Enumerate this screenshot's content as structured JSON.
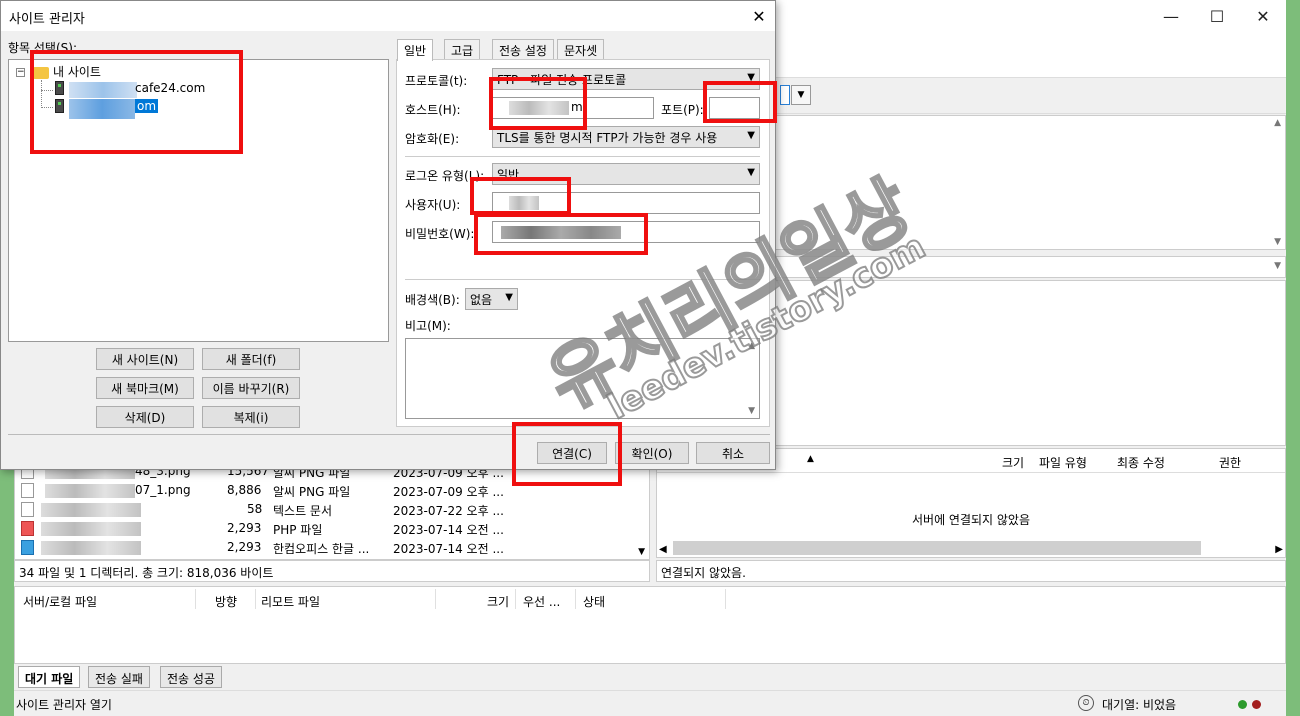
{
  "app": {
    "window_controls": {
      "minimize": "—",
      "maximize": "☐",
      "close": "✕"
    },
    "local_files": [
      {
        "name_suffix": "48_3.png",
        "size": "15,567",
        "type": "알씨 PNG 파일",
        "modified": "2023-07-09 오후 ..."
      },
      {
        "name_suffix": "07_1.png",
        "size": "8,886",
        "type": "알씨 PNG 파일",
        "modified": "2023-07-09 오후 ..."
      },
      {
        "name_suffix": "",
        "size": "58",
        "type": "텍스트 문서",
        "modified": "2023-07-22 오후 ..."
      },
      {
        "name_suffix": "",
        "size": "2,293",
        "type": "PHP 파일",
        "modified": "2023-07-14 오전 ..."
      },
      {
        "name_suffix": "",
        "size": "2,293",
        "type": "한컴오피스 한글 ...",
        "modified": "2023-07-14 오전 ..."
      }
    ],
    "local_status": "34 파일 및 1 디렉터리. 총 크기: 818,036 바이트",
    "remote_columns": {
      "size": "크기",
      "type": "파일 유형",
      "modified": "최종 수정",
      "perm": "권한"
    },
    "remote_empty": "서버에 연결되지 않았음",
    "remote_status": "연결되지 않았음.",
    "queue_columns": {
      "server_local": "서버/로컬 파일",
      "direction": "방향",
      "remote": "리모트 파일",
      "size": "크기",
      "priority": "우선 ...",
      "status": "상태"
    },
    "queue_tabs": [
      "대기 파일",
      "전송 실패",
      "전송 성공"
    ],
    "statusbar": {
      "text": "사이트 관리자 열기",
      "queue": "대기열: 비었음"
    }
  },
  "dialog": {
    "title": "사이트 관리자",
    "close": "✕",
    "select_label": "항목 선택(S):",
    "tree": {
      "root": "내 사이트",
      "expander": "−",
      "site1_suffix": "cafe24.com",
      "site2_suffix": "om"
    },
    "left_buttons": {
      "new_site": "새 사이트(N)",
      "new_folder": "새 폴더(f)",
      "new_bookmark": "새 북마크(M)",
      "rename": "이름 바꾸기(R)",
      "delete": "삭제(D)",
      "duplicate": "복제(i)"
    },
    "tabs": [
      "일반",
      "고급",
      "전송 설정",
      "문자셋"
    ],
    "general": {
      "protocol_label": "프로토콜(t):",
      "protocol_value": "FTP - 파일 전송 프로토콜",
      "host_label": "호스트(H):",
      "host_value_suffix": "m",
      "port_label": "포트(P):",
      "port_value": "",
      "encryption_label": "암호화(E):",
      "encryption_value": "TLS를 통한 명시적 FTP가 가능한 경우 사용",
      "logon_label": "로그온 유형(L):",
      "logon_value": "일반",
      "user_label": "사용자(U):",
      "password_label": "비밀번호(W):",
      "bgcolor_label": "배경색(B):",
      "bgcolor_value": "없음",
      "comment_label": "비고(M):"
    },
    "footer_buttons": {
      "connect": "연결(C)",
      "ok": "확인(O)",
      "cancel": "취소"
    }
  },
  "watermark": {
    "main": "유치리의일상",
    "sub": "leedev.tistory.com"
  },
  "colors": {
    "highlight": "#ef0f0f",
    "desktop": "#7dbd7a",
    "selection": "#0078d7"
  }
}
